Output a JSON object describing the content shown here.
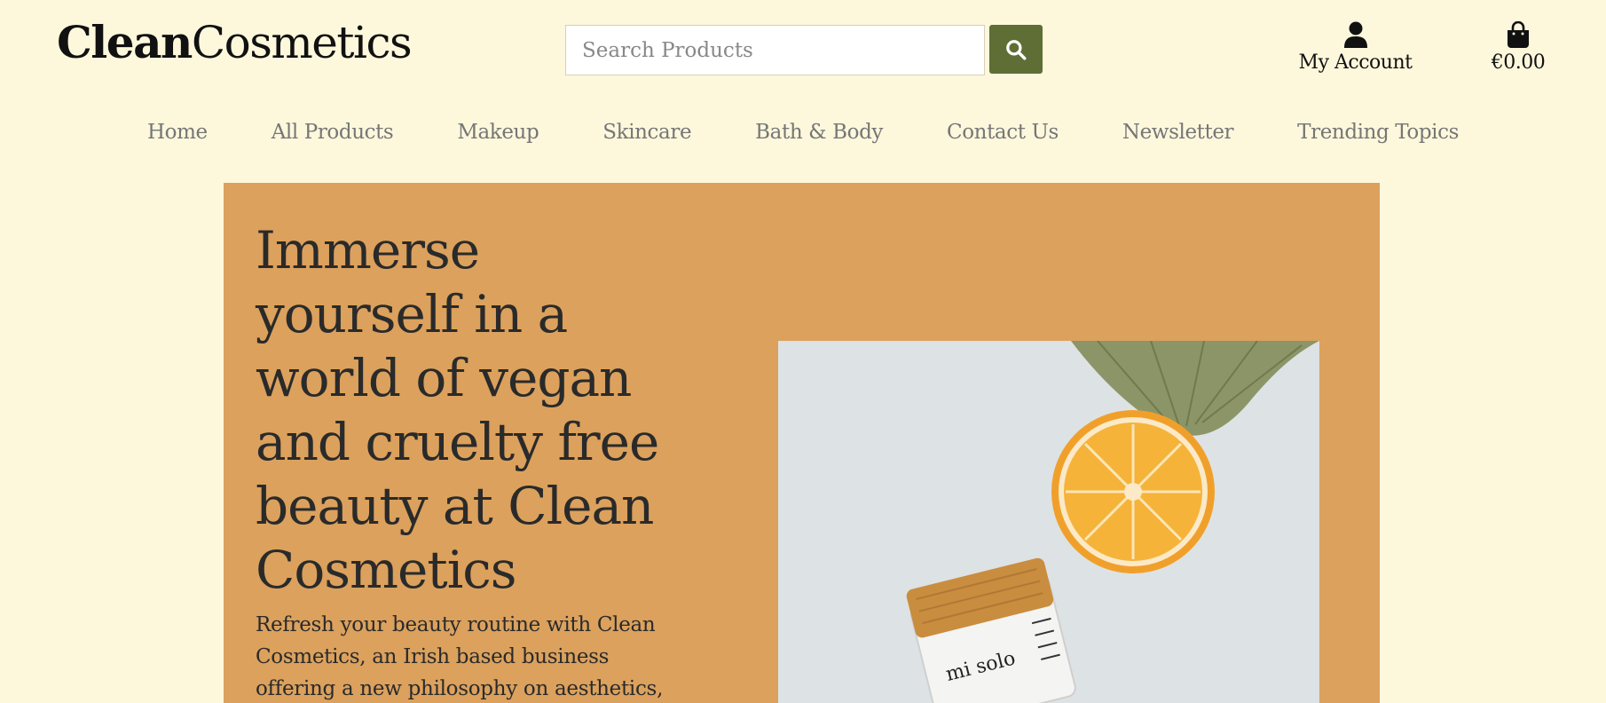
{
  "brand": {
    "name_bold": "Clean",
    "name_regular": "Cosmetics"
  },
  "search": {
    "placeholder": "Search Products",
    "icon": "search-icon"
  },
  "account": {
    "label": "My Account",
    "icon": "user-icon"
  },
  "cart": {
    "total": "€0.00",
    "icon": "shopping-bag-icon"
  },
  "nav": {
    "items": [
      "Home",
      "All Products",
      "Makeup",
      "Skincare",
      "Bath & Body",
      "Contact Us",
      "Newsletter",
      "Trending Topics"
    ]
  },
  "hero": {
    "heading": "Immerse yourself in a world of vegan and cruelty free beauty at Clean Cosmetics",
    "body": "Refresh your beauty routine with Clean Cosmetics, an Irish based business offering a new philosophy on aesthetics, including",
    "product_jar_text": "mi solo",
    "colors": {
      "background": "#dba15d",
      "page": "#fdf8dc",
      "accent": "#5f6e35"
    }
  }
}
